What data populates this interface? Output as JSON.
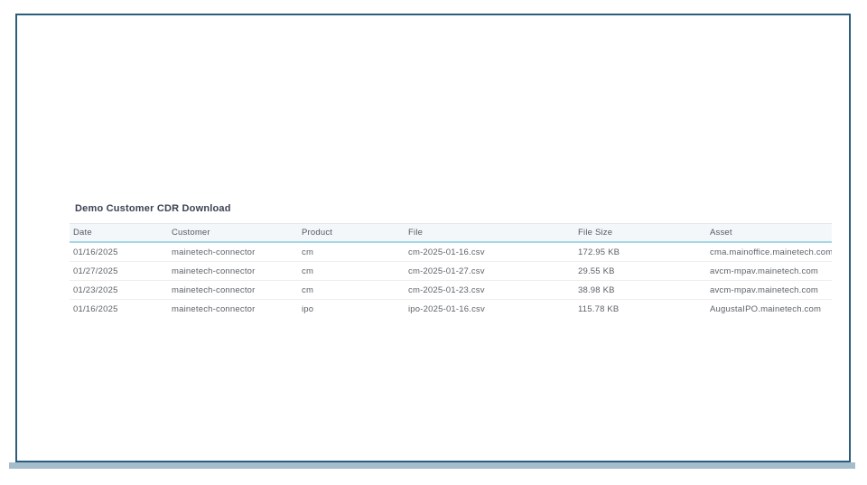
{
  "page": {
    "title": "Demo Customer CDR Download"
  },
  "table": {
    "columns": [
      {
        "key": "date",
        "label": "Date"
      },
      {
        "key": "customer",
        "label": "Customer"
      },
      {
        "key": "product",
        "label": "Product"
      },
      {
        "key": "file",
        "label": "File"
      },
      {
        "key": "file_size",
        "label": "File Size"
      },
      {
        "key": "asset",
        "label": "Asset"
      }
    ],
    "rows": [
      {
        "date": "01/16/2025",
        "customer": "mainetech-connector",
        "product": "cm",
        "file": "cm-2025-01-16.csv",
        "file_size": "172.95 KB",
        "asset": "cma.mainoffice.mainetech.com"
      },
      {
        "date": "01/27/2025",
        "customer": "mainetech-connector",
        "product": "cm",
        "file": "cm-2025-01-27.csv",
        "file_size": "29.55 KB",
        "asset": "avcm-mpav.mainetech.com"
      },
      {
        "date": "01/23/2025",
        "customer": "mainetech-connector",
        "product": "cm",
        "file": "cm-2025-01-23.csv",
        "file_size": "38.98 KB",
        "asset": "avcm-mpav.mainetech.com"
      },
      {
        "date": "01/16/2025",
        "customer": "mainetech-connector",
        "product": "ipo",
        "file": "ipo-2025-01-16.csv",
        "file_size": "115.78 KB",
        "asset": "AugustaIPO.mainetech.com"
      }
    ]
  },
  "colors": {
    "frame_border": "#2b5d7c",
    "bottom_bar": "#a4bdcc",
    "header_bg": "#f3f7fa",
    "header_accent_border": "#a7d7e8",
    "row_separator": "#eeeeee",
    "title_text": "#3c4354",
    "header_text": "#555b64",
    "cell_text": "#5d6269"
  }
}
